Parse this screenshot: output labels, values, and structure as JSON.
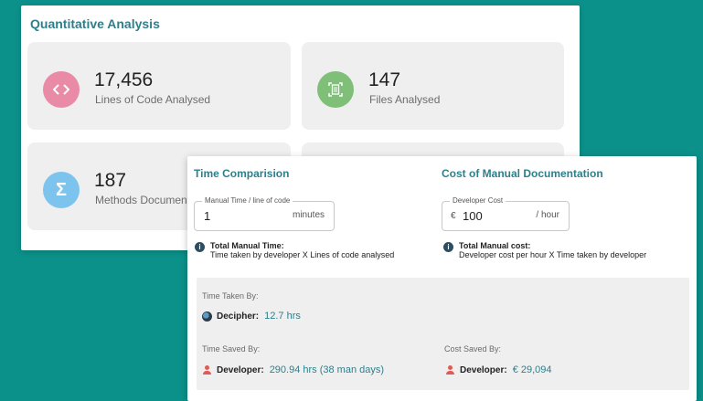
{
  "quantitative": {
    "title": "Quantitative Analysis",
    "stats": [
      {
        "value": "17,456",
        "label": "Lines of Code Analysed",
        "icon": "code-icon",
        "color": "#e98aa6"
      },
      {
        "value": "147",
        "label": "Files Analysed",
        "icon": "file-icon",
        "color": "#7fbf78"
      },
      {
        "value": "187",
        "label": "Methods Documented",
        "icon": "sigma-icon",
        "color": "#7cc4ee"
      }
    ]
  },
  "time": {
    "title": "Time Comparision",
    "field_label": "Manual Time / line of code",
    "field_value": "1",
    "field_unit": "minutes",
    "info_title": "Total Manual Time:",
    "info_text": "Time taken by developer X Lines of code analysed"
  },
  "cost": {
    "title": "Cost of Manual Documentation",
    "field_label": "Developer Cost",
    "currency": "€",
    "field_value": "100",
    "field_unit": "/ hour",
    "info_title": "Total Manual cost:",
    "info_text": "Developer cost per hour X Time taken by developer"
  },
  "summary": {
    "taken_label": "Time Taken By:",
    "taken_who": "Decipher:",
    "taken_value": "12.7 hrs",
    "saved_label": "Time Saved By:",
    "saved_who": "Developer:",
    "saved_value": "290.94 hrs (38 man days)",
    "cost_label": "Cost Saved By:",
    "cost_who": "Developer:",
    "cost_value": "€ 29,094"
  },
  "colors": {
    "accent": "#2f7f8a",
    "background": "#0b918a"
  }
}
